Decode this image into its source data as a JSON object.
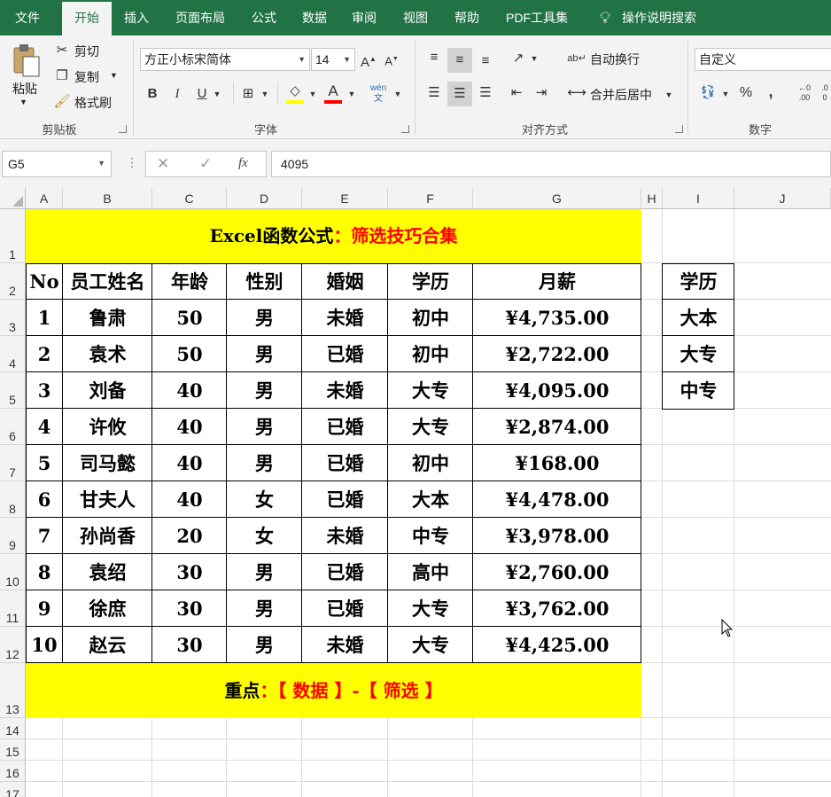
{
  "menu": {
    "tabs": [
      "文件",
      "开始",
      "插入",
      "页面布局",
      "公式",
      "数据",
      "审阅",
      "视图",
      "帮助",
      "PDF工具集"
    ],
    "tell_me": "操作说明搜索"
  },
  "ribbon": {
    "clipboard": {
      "paste": "粘贴",
      "cut": "剪切",
      "copy": "复制",
      "format_painter": "格式刷",
      "label": "剪贴板"
    },
    "font": {
      "name": "方正小标宋简体",
      "size": "14",
      "bold": "B",
      "italic": "I",
      "underline": "U",
      "label": "字体",
      "colors": {
        "highlight": "#ffff00",
        "font": "#ff0000"
      }
    },
    "align": {
      "wrap": "自动换行",
      "merge": "合并后居中",
      "label": "对齐方式"
    },
    "number": {
      "format": "自定义",
      "percent": "%",
      "comma": ",",
      "label": "数字"
    }
  },
  "formula_bar": {
    "name_box": "G5",
    "fx": "fx",
    "value": "4095"
  },
  "sheet": {
    "columns": [
      "A",
      "B",
      "C",
      "D",
      "E",
      "F",
      "G",
      "H",
      "I",
      "J"
    ],
    "rows": [
      "1",
      "2",
      "3",
      "4",
      "5",
      "6",
      "7",
      "8",
      "9",
      "10",
      "11",
      "12",
      "13",
      "14",
      "15",
      "16",
      "17"
    ],
    "title_black": "Excel函数公式",
    "title_red": "：筛选技巧合集",
    "header": [
      "No",
      "员工姓名",
      "年龄",
      "性别",
      "婚姻",
      "学历",
      "月薪"
    ],
    "data": [
      [
        "1",
        "鲁肃",
        "50",
        "男",
        "未婚",
        "初中",
        "¥4,735.00"
      ],
      [
        "2",
        "袁术",
        "50",
        "男",
        "已婚",
        "初中",
        "¥2,722.00"
      ],
      [
        "3",
        "刘备",
        "40",
        "男",
        "未婚",
        "大专",
        "¥4,095.00"
      ],
      [
        "4",
        "许攸",
        "40",
        "男",
        "已婚",
        "大专",
        "¥2,874.00"
      ],
      [
        "5",
        "司马懿",
        "40",
        "男",
        "已婚",
        "初中",
        "¥168.00"
      ],
      [
        "6",
        "甘夫人",
        "40",
        "女",
        "已婚",
        "大本",
        "¥4,478.00"
      ],
      [
        "7",
        "孙尚香",
        "20",
        "女",
        "未婚",
        "中专",
        "¥3,978.00"
      ],
      [
        "8",
        "袁绍",
        "30",
        "男",
        "已婚",
        "高中",
        "¥2,760.00"
      ],
      [
        "9",
        "徐庶",
        "30",
        "男",
        "已婚",
        "大专",
        "¥3,762.00"
      ],
      [
        "10",
        "赵云",
        "30",
        "男",
        "未婚",
        "大专",
        "¥4,425.00"
      ]
    ],
    "footer_black": "重点",
    "footer_red": "：【 数据 】-【 筛选 】",
    "criteria_header": "学历",
    "criteria": [
      "大本",
      "大专",
      "中专"
    ],
    "colors": {
      "band": "#ffff00",
      "accent_red": "#ff0000",
      "excel_green": "#217346"
    }
  }
}
